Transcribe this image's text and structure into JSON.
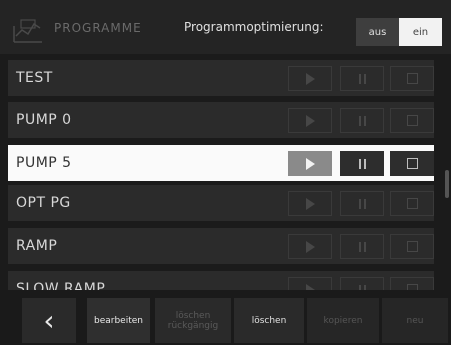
{
  "header": {
    "title": "PROGRAMME",
    "optimization_label": "Programmoptimierung:",
    "toggle": {
      "off_label": "aus",
      "on_label": "ein",
      "selected": "ein"
    }
  },
  "programs": [
    {
      "name": "TEST",
      "active": false
    },
    {
      "name": "PUMP 0",
      "active": false
    },
    {
      "name": "PUMP 5",
      "active": true
    },
    {
      "name": "OPT PG",
      "active": false
    },
    {
      "name": "RAMP",
      "active": false
    },
    {
      "name": "SLOW RAMP",
      "active": false
    }
  ],
  "row_icons": {
    "play": "play-icon",
    "pause": "pause-icon",
    "stop": "stop-icon"
  },
  "footer": {
    "back_icon": "chevron-left-icon",
    "back_glyph": "‹",
    "edit_label": "bearbeiten",
    "reset_label": "löschen rückgängig",
    "delete_label": "löschen",
    "copy_label": "kopieren",
    "new_label": "neu"
  }
}
